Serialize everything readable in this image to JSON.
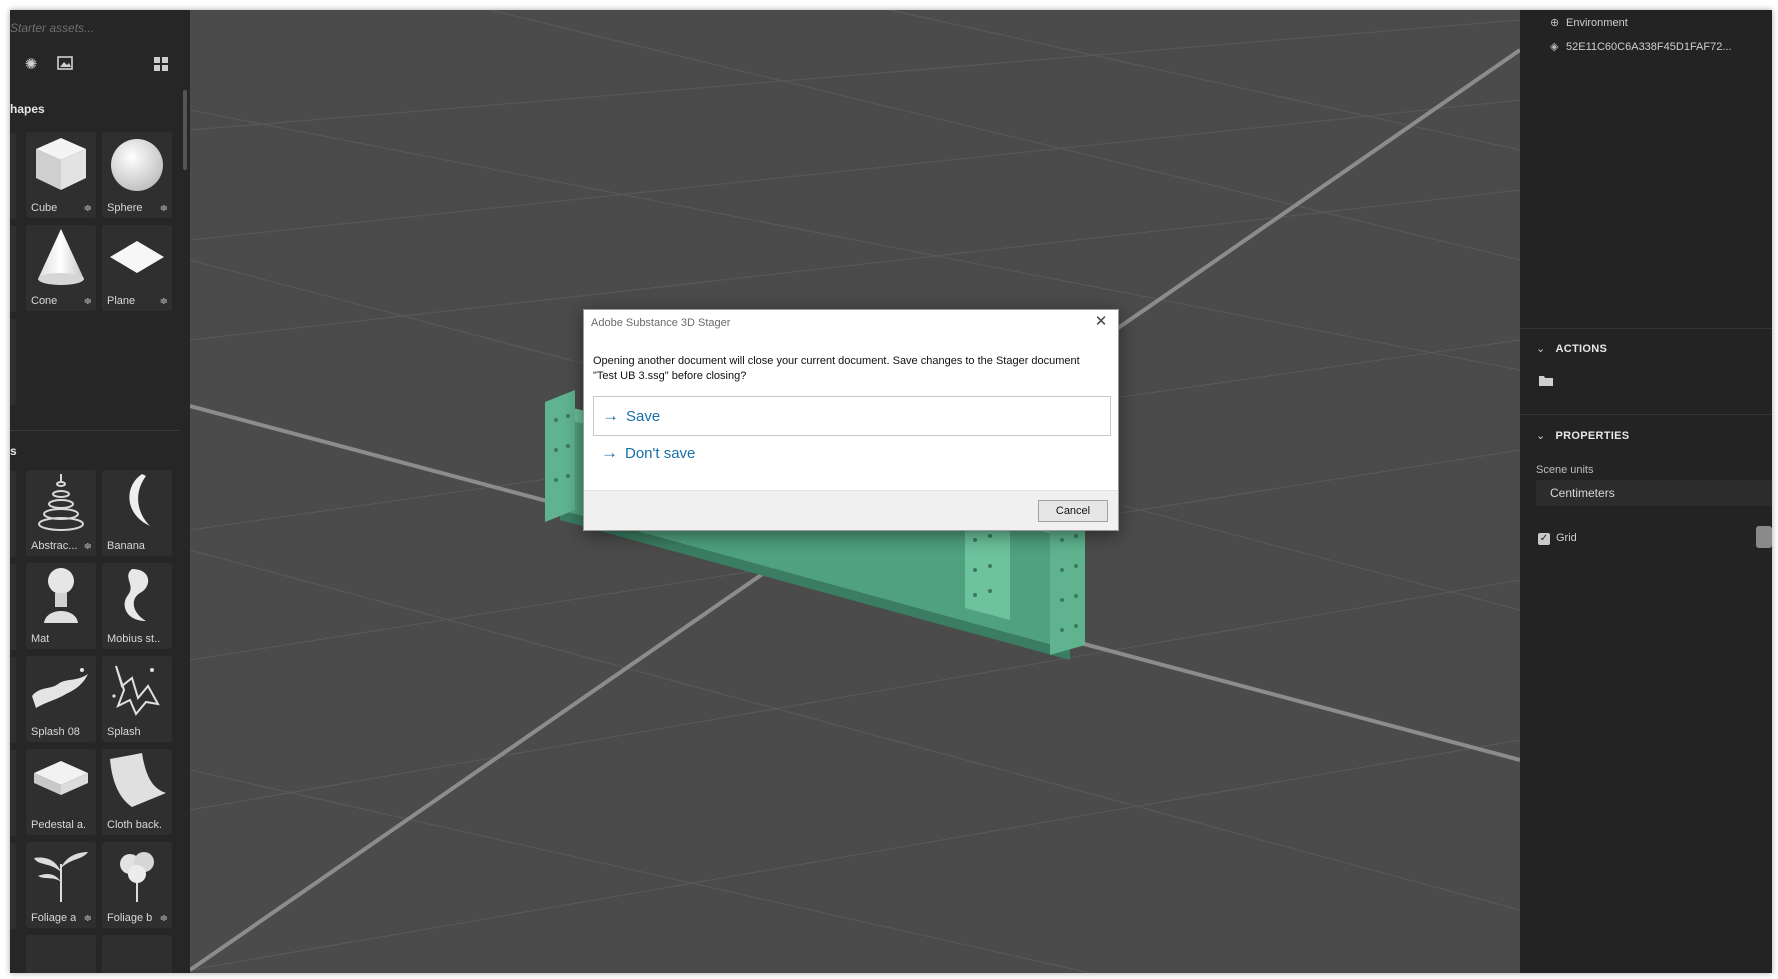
{
  "window": {
    "title": "Adobe Substance 3D Stager"
  },
  "assets_panel": {
    "search_placeholder": "Starter assets...",
    "sections": [
      {
        "title": "hapes"
      },
      {
        "title": "s"
      }
    ],
    "shapes": [
      {
        "label": "Cube",
        "icon": "cube-icon"
      },
      {
        "label": "Sphere",
        "icon": "sphere-icon"
      },
      {
        "label": "Cone",
        "icon": "cone-icon"
      },
      {
        "label": "Plane",
        "icon": "plane-icon"
      }
    ],
    "models": [
      {
        "label": "Abstrac...",
        "icon": "abstract-spiral-icon"
      },
      {
        "label": "Banana",
        "icon": "banana-icon"
      },
      {
        "label": "Mat",
        "icon": "mannequin-icon"
      },
      {
        "label": "Mobius st...",
        "icon": "mobius-strip-icon"
      },
      {
        "label": "Splash 08",
        "icon": "splash-icon"
      },
      {
        "label": "Splash",
        "icon": "splash-icon"
      },
      {
        "label": "Pedestal a...",
        "icon": "pedestal-icon"
      },
      {
        "label": "Cloth back...",
        "icon": "cloth-backdrop-icon"
      },
      {
        "label": "Foliage a",
        "icon": "foliage-icon"
      },
      {
        "label": "Foliage b",
        "icon": "foliage-icon"
      }
    ]
  },
  "scene_tree": {
    "items": [
      {
        "label": "Environment",
        "icon": "globe-icon"
      },
      {
        "label": "52E11C60C6A338F45D1FAF72...",
        "icon": "model-icon"
      }
    ]
  },
  "actions": {
    "header": "ACTIONS"
  },
  "properties": {
    "header": "PROPERTIES",
    "scene_units_label": "Scene units",
    "scene_units_value": "Centimeters",
    "grid_label": "Grid",
    "grid_checked": true
  },
  "dialog": {
    "title": "Adobe Substance 3D Stager",
    "message": "Opening another document will close your current document. Save changes to the Stager document \"Test  UB 3.ssg\" before closing?",
    "save_label": "Save",
    "dont_save_label": "Don't save",
    "cancel_label": "Cancel"
  },
  "colors": {
    "accent_link": "#1a6ea8",
    "viewport_bg": "#4b4b4b",
    "model_green": "#5fb48f"
  }
}
